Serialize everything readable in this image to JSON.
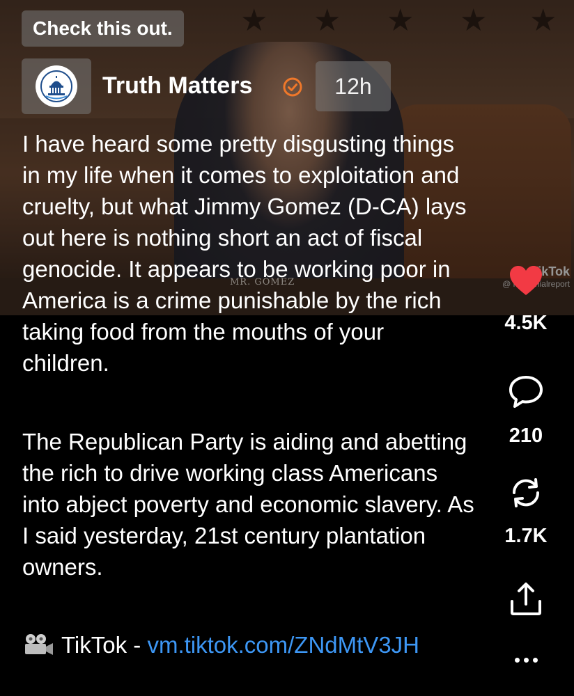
{
  "header": {
    "label": "Check this out.",
    "author_name": "Truth Matters",
    "time": "12h"
  },
  "video": {
    "nameplate": "MR. GOMEZ",
    "watermark_name": "TikTok",
    "watermark_handle": "@ millennialreport"
  },
  "post": {
    "paragraphs": [
      "I have heard some pretty disgusting things in my life when it comes to exploitation and cruelty, but what Jimmy Gomez (D-CA) lays out here is nothing short an act of fiscal genocide. It appears to be working poor in America is a crime punishable by the rich taking food from the mouths of your children.",
      "The Republican Party is aiding and abetting the rich to drive working class Americans into abject poverty and economic slavery. As I said yesterday, 21st century plantation owners."
    ],
    "link_prefix": "TikTok - ",
    "link_text": "vm.tiktok.com/ZNdMtV3JH"
  },
  "actions": {
    "likes": "4.5K",
    "replies": "210",
    "reposts": "1.7K"
  },
  "icons": {
    "avatar": "capitol-dome-logo",
    "verified": "verified-check-icon",
    "like": "heart-icon",
    "reply": "comment-bubble-icon",
    "repost": "repost-arrows-icon",
    "share": "share-icon",
    "more": "more-dots-icon",
    "camera": "movie-camera-icon"
  },
  "colors": {
    "heart": "#f23a44",
    "verified": "#f0782a",
    "link": "#3d97f5",
    "avatar_blue": "#1f4e8c"
  }
}
